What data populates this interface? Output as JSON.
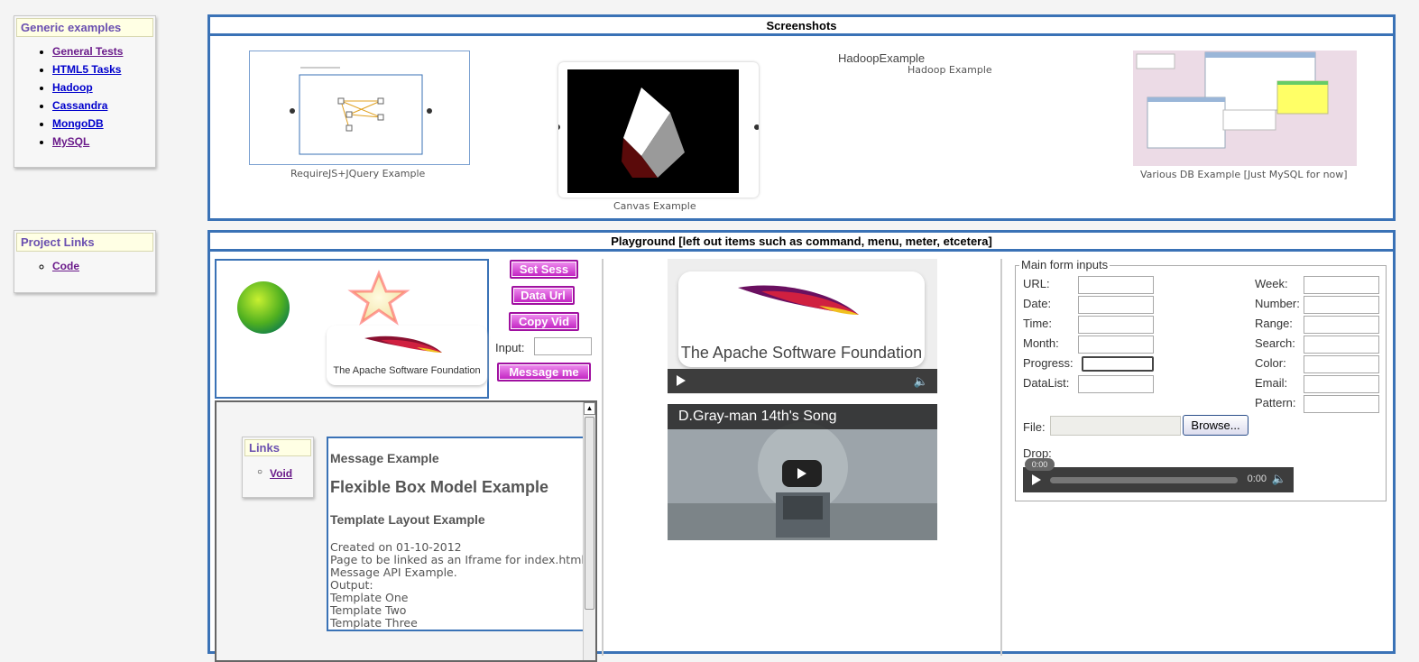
{
  "generic": {
    "title": "Generic examples",
    "items": [
      "General Tests",
      "HTML5 Tasks",
      "Hadoop",
      "Cassandra",
      "MongoDB",
      "MySQL"
    ]
  },
  "project_links": {
    "title": "Project Links",
    "items": [
      "Code"
    ]
  },
  "screenshots": {
    "title": "Screenshots",
    "items": [
      {
        "caption": "RequireJS+JQuery Example"
      },
      {
        "caption": "Canvas Example"
      },
      {
        "caption": "Hadoop Example",
        "alt": "HadoopExample"
      },
      {
        "caption": "Various DB Example [Just MySQL for now]"
      }
    ]
  },
  "playground": {
    "title": "Playground [left out items such as command, menu, meter, etcetera]",
    "apache_text": "The Apache Software Foundation",
    "buttons": {
      "set_sess": "Set Sess",
      "data_url": "Data Url",
      "copy_vid": "Copy Vid",
      "message_me": "Message me"
    },
    "input_label": "Input:",
    "iframe": {
      "links_title": "Links",
      "links_item": "Void",
      "h_message": "Message Example",
      "h_flex": "Flexible Box Model Example",
      "h_template": "Template Layout Example",
      "lines": [
        "Created on 01-10-2012",
        "Page to be linked as an Iframe for index.html",
        "Message API Example.",
        "Output:",
        "Template One",
        "Template Two",
        "Template Three"
      ]
    },
    "video_title": "D.Gray-man 14th's Song",
    "form": {
      "legend": "Main form inputs",
      "left_labels": [
        "URL:",
        "Date:",
        "Time:",
        "Month:",
        "Progress:",
        "DataList:"
      ],
      "right_labels": [
        "Week:",
        "Number:",
        "Range:",
        "Search:",
        "Color:",
        "Email:",
        "Pattern:"
      ],
      "file_label": "File:",
      "browse": "Browse...",
      "drop_label": "Drop:",
      "audio_tip": "0:00",
      "audio_time": "0:00"
    }
  },
  "colors": {
    "accent_blue": "#3a72b6",
    "title_purple": "#6a4fb0",
    "button_magenta": "#c020c0"
  }
}
